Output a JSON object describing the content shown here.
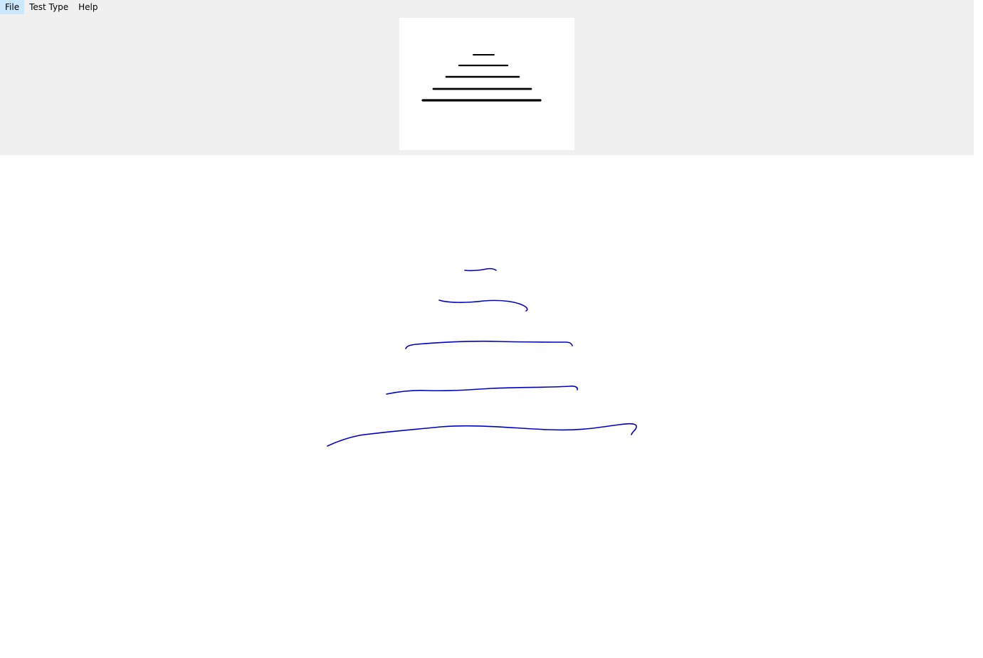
{
  "menu": {
    "items": [
      {
        "label": "File"
      },
      {
        "label": "Test Type"
      },
      {
        "label": "Help"
      }
    ]
  },
  "reference": {
    "stroke_color": "#000000",
    "line_count": 5
  },
  "drawing": {
    "stroke_color": "#0000cc",
    "stroke_count": 5
  }
}
